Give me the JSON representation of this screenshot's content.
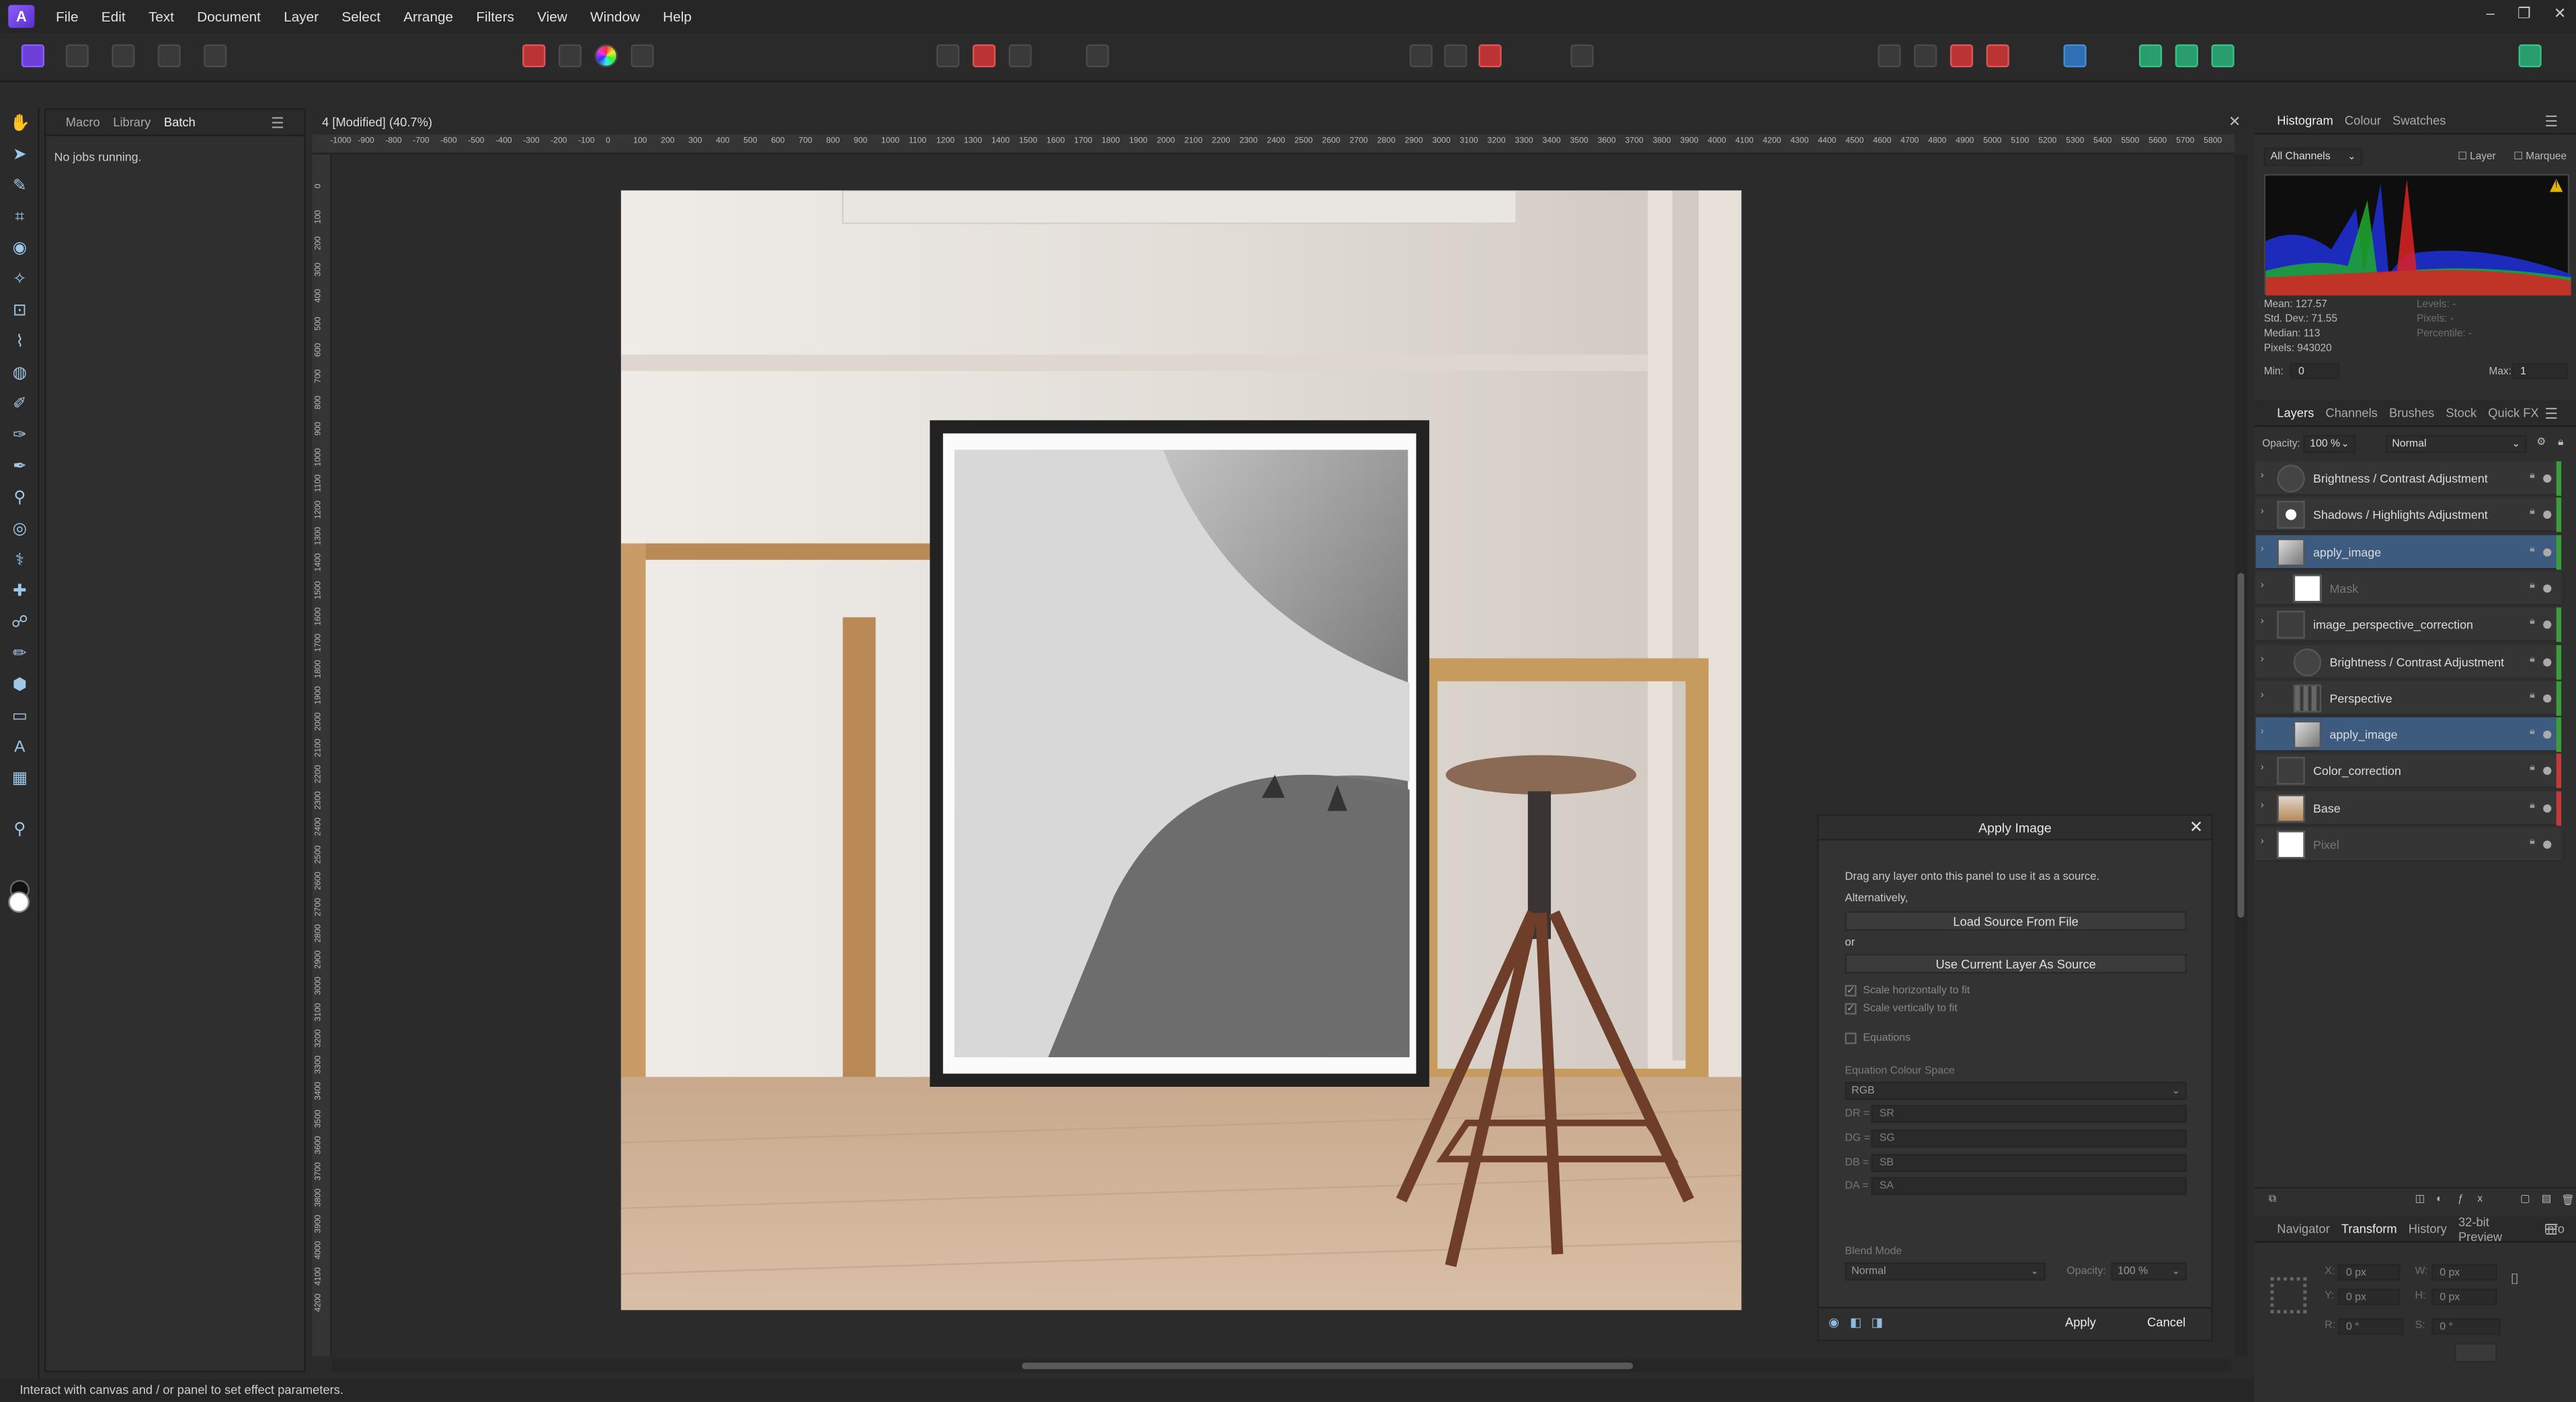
{
  "menubar": {
    "items": [
      "File",
      "Edit",
      "Text",
      "Document",
      "Layer",
      "Select",
      "Arrange",
      "Filters",
      "View",
      "Window",
      "Help"
    ],
    "window_controls": [
      "–",
      "❐",
      "✕"
    ]
  },
  "left_panel": {
    "tabs": [
      "Macro",
      "Library",
      "Batch"
    ],
    "active_tab": "Batch",
    "status": "No jobs running."
  },
  "document": {
    "tab_title": "4 [Modified] (40.7%)",
    "ruler_h": [
      "-1000",
      "-900",
      "-800",
      "-700",
      "-600",
      "-500",
      "-400",
      "-300",
      "-200",
      "-100",
      "0",
      "100",
      "200",
      "300",
      "400",
      "500",
      "600",
      "700",
      "800",
      "900",
      "1000",
      "1100",
      "1200",
      "1300",
      "1400",
      "1500",
      "1600",
      "1700",
      "1800",
      "1900",
      "2000",
      "2100",
      "2200",
      "2300",
      "2400",
      "2500",
      "2600",
      "2700",
      "2800",
      "2900",
      "3000",
      "3100",
      "3200",
      "3300",
      "3400",
      "3500",
      "3600",
      "3700",
      "3800",
      "3900",
      "4000",
      "4100",
      "4200",
      "4300",
      "4400",
      "4500",
      "4600",
      "4700",
      "4800",
      "4900",
      "5000",
      "5100",
      "5200",
      "5300",
      "5400",
      "5500",
      "5600",
      "5700",
      "5800"
    ],
    "ruler_v": [
      "0",
      "100",
      "200",
      "300",
      "400",
      "500",
      "600",
      "700",
      "800",
      "900",
      "1000",
      "1100",
      "1200",
      "1300",
      "1400",
      "1500",
      "1600",
      "1700",
      "1800",
      "1900",
      "2000",
      "2100",
      "2200",
      "2300",
      "2400",
      "2500",
      "2600",
      "2700",
      "2800",
      "2900",
      "3000",
      "3100",
      "3200",
      "3300",
      "3400",
      "3500",
      "3600",
      "3700",
      "3800",
      "3900",
      "4000",
      "4100",
      "4200"
    ]
  },
  "apply_image": {
    "title": "Apply Image",
    "hint": "Drag any layer onto this panel to use it as a source.",
    "alternatively": "Alternatively,",
    "load_button": "Load Source From File",
    "or": "or",
    "use_current_button": "Use Current Layer As Source",
    "scale_h": "Scale horizontally to fit",
    "scale_v": "Scale vertically to fit",
    "equations": "Equations",
    "eq_colour_space_label": "Equation Colour Space",
    "eq_colour_space": "RGB",
    "eq_rows": [
      {
        "label": "DR =",
        "value": "SR"
      },
      {
        "label": "DG =",
        "value": "SG"
      },
      {
        "label": "DB =",
        "value": "SB"
      },
      {
        "label": "DA =",
        "value": "SA"
      }
    ],
    "blend_mode_label": "Blend Mode",
    "blend_mode": "Normal",
    "opacity_label": "Opacity:",
    "opacity": "100 %",
    "apply": "Apply",
    "cancel": "Cancel"
  },
  "histogram": {
    "tabs": [
      "Histogram",
      "Colour",
      "Swatches"
    ],
    "active_tab": "Histogram",
    "channel": "All Channels",
    "layer_label": "Layer",
    "marquee_label": "Marquee",
    "stats_left": [
      "Mean: 127.57",
      "Std. Dev.: 71.55",
      "Median: 113",
      "Pixels: 943020"
    ],
    "stats_right": [
      "Levels: -",
      "Pixels: -",
      "Percentile: -"
    ],
    "min_label": "Min:",
    "min": "0",
    "max_label": "Max:",
    "max": "1",
    "warning_icon": "!"
  },
  "layers_panel": {
    "tabs": [
      "Layers",
      "Channels",
      "Brushes",
      "Stock",
      "Quick FX"
    ],
    "active_tab": "Layers",
    "opacity_label": "Opacity:",
    "opacity": "100 %",
    "blend": "Normal",
    "layers": [
      {
        "name": "Brightness / Contrast Adjustment",
        "indent": 0,
        "selected": false,
        "dim": false,
        "stripe": "#3a9d3a",
        "thumb": "adjust-bc"
      },
      {
        "name": "Shadows / Highlights Adjustment",
        "indent": 0,
        "selected": false,
        "dim": false,
        "stripe": "#3a9d3a",
        "thumb": "adjust-sh"
      },
      {
        "name": "apply_image",
        "indent": 0,
        "selected": true,
        "dim": false,
        "stripe": "#3a9d3a",
        "thumb": "image"
      },
      {
        "name": "Mask",
        "indent": 1,
        "selected": false,
        "dim": true,
        "stripe": "",
        "thumb": "mask"
      },
      {
        "name": "image_perspective_correction",
        "indent": 0,
        "selected": false,
        "dim": false,
        "stripe": "#3a9d3a",
        "thumb": "group"
      },
      {
        "name": "Brightness / Contrast Adjustment",
        "indent": 1,
        "selected": false,
        "dim": false,
        "stripe": "#3a9d3a",
        "thumb": "adjust-bc"
      },
      {
        "name": "Perspective",
        "indent": 1,
        "selected": false,
        "dim": false,
        "stripe": "#3a9d3a",
        "thumb": "perspective"
      },
      {
        "name": "apply_image",
        "indent": 1,
        "selected": true,
        "dim": false,
        "stripe": "#3a9d3a",
        "thumb": "image"
      },
      {
        "name": "Color_correction",
        "indent": 0,
        "selected": false,
        "dim": false,
        "stripe": "#c23b3b",
        "thumb": "group"
      },
      {
        "name": "Base",
        "indent": 0,
        "selected": false,
        "dim": false,
        "stripe": "#c23b3b",
        "thumb": "photo"
      },
      {
        "name": "Pixel",
        "indent": 0,
        "selected": false,
        "dim": true,
        "stripe": "",
        "thumb": "white"
      }
    ]
  },
  "transform_panel": {
    "tabs": [
      "Navigator",
      "Transform",
      "History",
      "32-bit Preview",
      "Info"
    ],
    "active_tab": "Transform",
    "x_label": "X:",
    "x": "0 px",
    "y_label": "Y:",
    "y": "0 px",
    "w_label": "W:",
    "w": "0 px",
    "h_label": "H:",
    "h": "0 px",
    "r_label": "R:",
    "r": "0 °",
    "s_label": "S:",
    "s": "0 °"
  },
  "statusbar": {
    "text": "Interact with canvas and / or panel to set effect parameters."
  }
}
